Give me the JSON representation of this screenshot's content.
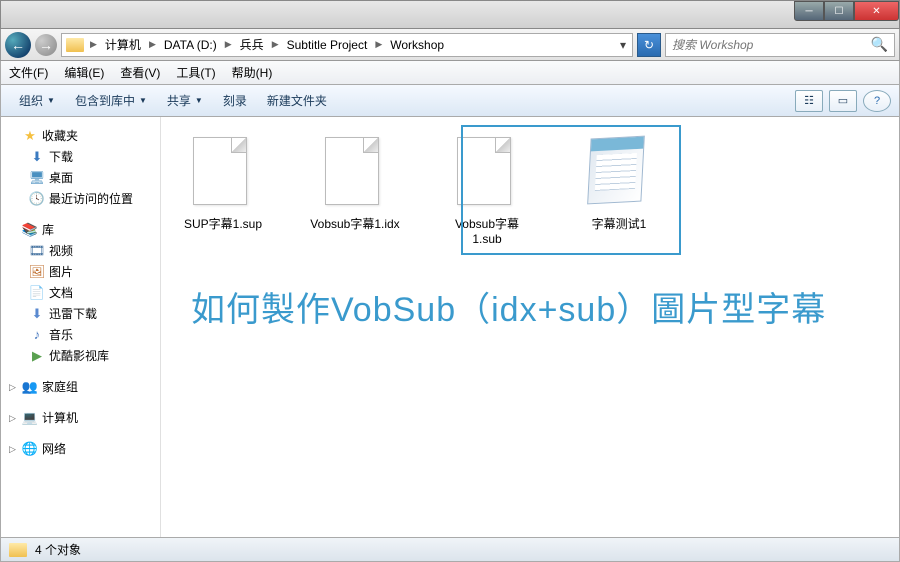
{
  "window": {
    "controls": {
      "min": "─",
      "max": "☐",
      "close": "✕"
    }
  },
  "navbar": {
    "back": "←",
    "forward": "→",
    "breadcrumb": [
      "计算机",
      "DATA (D:)",
      "兵兵",
      "Subtitle Project",
      "Workshop"
    ],
    "refresh": "↻",
    "search_placeholder": "搜索 Workshop",
    "search_icon": "🔍"
  },
  "menubar": [
    "文件(F)",
    "编辑(E)",
    "查看(V)",
    "工具(T)",
    "帮助(H)"
  ],
  "toolbar": {
    "items": [
      "组织",
      "包含到库中",
      "共享",
      "刻录",
      "新建文件夹"
    ],
    "view_icon": "☷",
    "preview_icon": "▭",
    "help_icon": "?"
  },
  "sidebar": {
    "favorites": {
      "label": "收藏夹",
      "items": [
        "下载",
        "桌面",
        "最近访问的位置"
      ]
    },
    "library": {
      "label": "库",
      "items": [
        "视频",
        "图片",
        "文档",
        "迅雷下载",
        "音乐",
        "优酷影视库"
      ]
    },
    "homegroup": {
      "label": "家庭组"
    },
    "computer": {
      "label": "计算机"
    },
    "network": {
      "label": "网络"
    }
  },
  "files": [
    {
      "name": "SUP字幕1.sup",
      "type": "blank"
    },
    {
      "name": "Vobsub字幕1.idx",
      "type": "blank"
    },
    {
      "name": "Vobsub字幕1.sub",
      "type": "blank"
    },
    {
      "name": "字幕测试1",
      "type": "notepad"
    }
  ],
  "overlay": "如何製作VobSub（idx+sub）圖片型字幕",
  "statusbar": {
    "count": "4 个对象"
  }
}
